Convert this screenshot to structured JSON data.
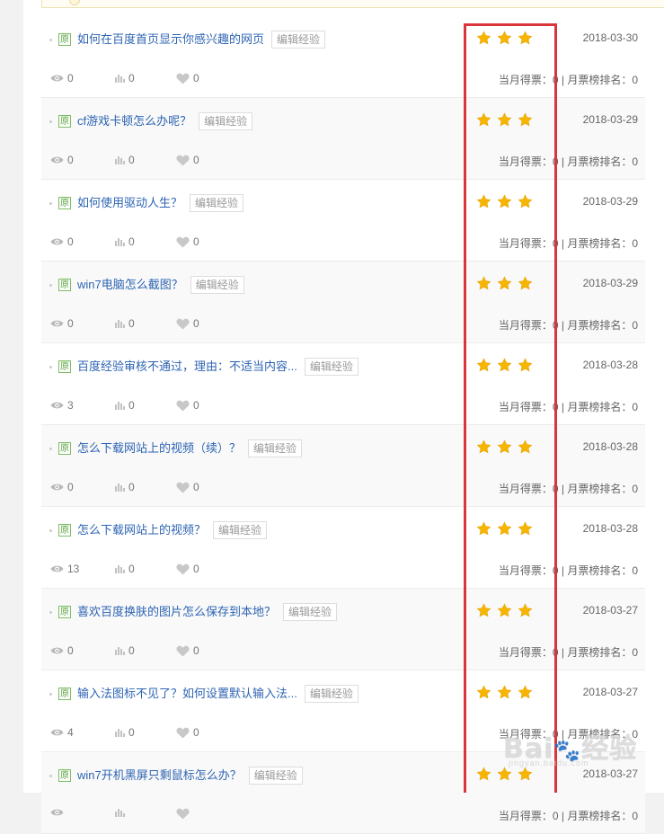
{
  "badge_label": "原",
  "edit_label": "编辑经验",
  "vote_label": "当月得票：0 | 月票榜排名：0",
  "colors": {
    "title_blue": "#2d64b3",
    "star_gold": "#f6b500",
    "highlight_red": "#d9363b",
    "badge_green": "#5da342"
  },
  "watermark": {
    "brand": "Bai",
    "brand_cn": "经验",
    "url": "jingyan.baidu.com"
  },
  "items": [
    {
      "title": "如何在百度首页显示你感兴趣的网页",
      "date": "2018-03-30",
      "views": "0",
      "votes": "0",
      "likes": "0",
      "stars": 3
    },
    {
      "title": "cf游戏卡顿怎么办呢？",
      "date": "2018-03-29",
      "views": "0",
      "votes": "0",
      "likes": "0",
      "stars": 3
    },
    {
      "title": "如何使用驱动人生？",
      "date": "2018-03-29",
      "views": "0",
      "votes": "0",
      "likes": "0",
      "stars": 3
    },
    {
      "title": "win7电脑怎么截图？",
      "date": "2018-03-29",
      "views": "0",
      "votes": "0",
      "likes": "0",
      "stars": 3
    },
    {
      "title": "百度经验审核不通过，理由：不适当内容...",
      "date": "2018-03-28",
      "views": "3",
      "votes": "0",
      "likes": "0",
      "stars": 3
    },
    {
      "title": "怎么下载网站上的视频（续）？",
      "date": "2018-03-28",
      "views": "0",
      "votes": "0",
      "likes": "0",
      "stars": 3
    },
    {
      "title": "怎么下载网站上的视频？",
      "date": "2018-03-28",
      "views": "13",
      "votes": "0",
      "likes": "0",
      "stars": 3
    },
    {
      "title": "喜欢百度换肤的图片怎么保存到本地？",
      "date": "2018-03-27",
      "views": "0",
      "votes": "0",
      "likes": "0",
      "stars": 3
    },
    {
      "title": "输入法图标不见了？如何设置默认输入法...",
      "date": "2018-03-27",
      "views": "4",
      "votes": "0",
      "likes": "0",
      "stars": 3
    },
    {
      "title": "win7开机黑屏只剩鼠标怎么办？",
      "date": "2018-03-27",
      "views": "",
      "votes": "",
      "likes": "",
      "stars": 3
    }
  ]
}
